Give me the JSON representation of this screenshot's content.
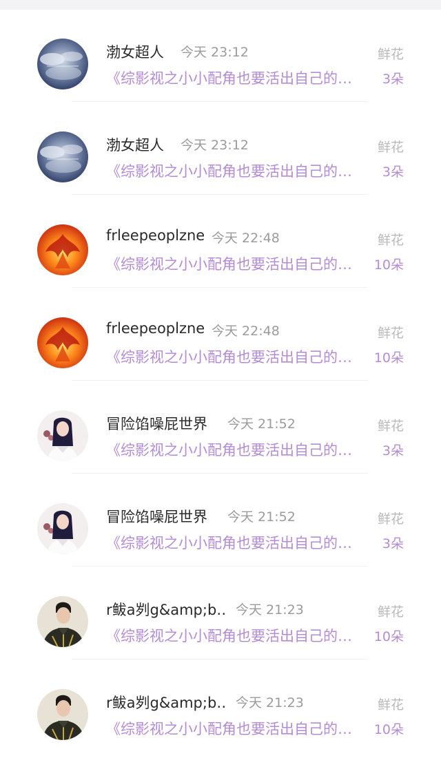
{
  "rows": [
    {
      "user": "渤女超人",
      "time": "今天 23:12",
      "book": "《综影视之小小配角也要活出自己的精彩》",
      "gift": "鲜花",
      "count": "3朵",
      "avatar": "sky-clouds-avatar"
    },
    {
      "user": "渤女超人",
      "time": "今天 23:12",
      "book": "《综影视之小小配角也要活出自己的精彩》",
      "gift": "鲜花",
      "count": "3朵",
      "avatar": "sky-clouds-avatar"
    },
    {
      "user": "frleepeoplzne",
      "time": "今天 22:48",
      "book": "《综影视之小小配角也要活出自己的精彩》",
      "gift": "鲜花",
      "count": "10朵",
      "avatar": "phoenix-avatar"
    },
    {
      "user": "frleepeoplzne",
      "time": "今天 22:48",
      "book": "《综影视之小小配角也要活出自己的精彩》",
      "gift": "鲜花",
      "count": "10朵",
      "avatar": "phoenix-avatar"
    },
    {
      "user": "冒险馅噪屁世界",
      "time": "今天 21:52",
      "book": "《综影视之小小配角也要活出自己的精彩》",
      "gift": "鲜花",
      "count": "3朵",
      "avatar": "woman-portrait-avatar"
    },
    {
      "user": "冒险馅噪屁世界",
      "time": "今天 21:52",
      "book": "《综影视之小小配角也要活出自己的精彩》",
      "gift": "鲜花",
      "count": "3朵",
      "avatar": "woman-portrait-avatar"
    },
    {
      "user": "r鲅a刿g&amp;b…",
      "time": "今天 21:23",
      "book": "《综影视之小小配角也要活出自己的精彩》",
      "gift": "鲜花",
      "count": "10朵",
      "avatar": "man-portrait-avatar"
    },
    {
      "user": "r鲅a刿g&amp;b…",
      "time": "今天 21:23",
      "book": "《综影视之小小配角也要活出自己的精彩》",
      "gift": "鲜花",
      "count": "10朵",
      "avatar": "man-portrait-avatar"
    }
  ],
  "colors": {
    "accent": "#b48bd6",
    "muted": "#9b9b9b",
    "name": "#2a2a2a"
  }
}
